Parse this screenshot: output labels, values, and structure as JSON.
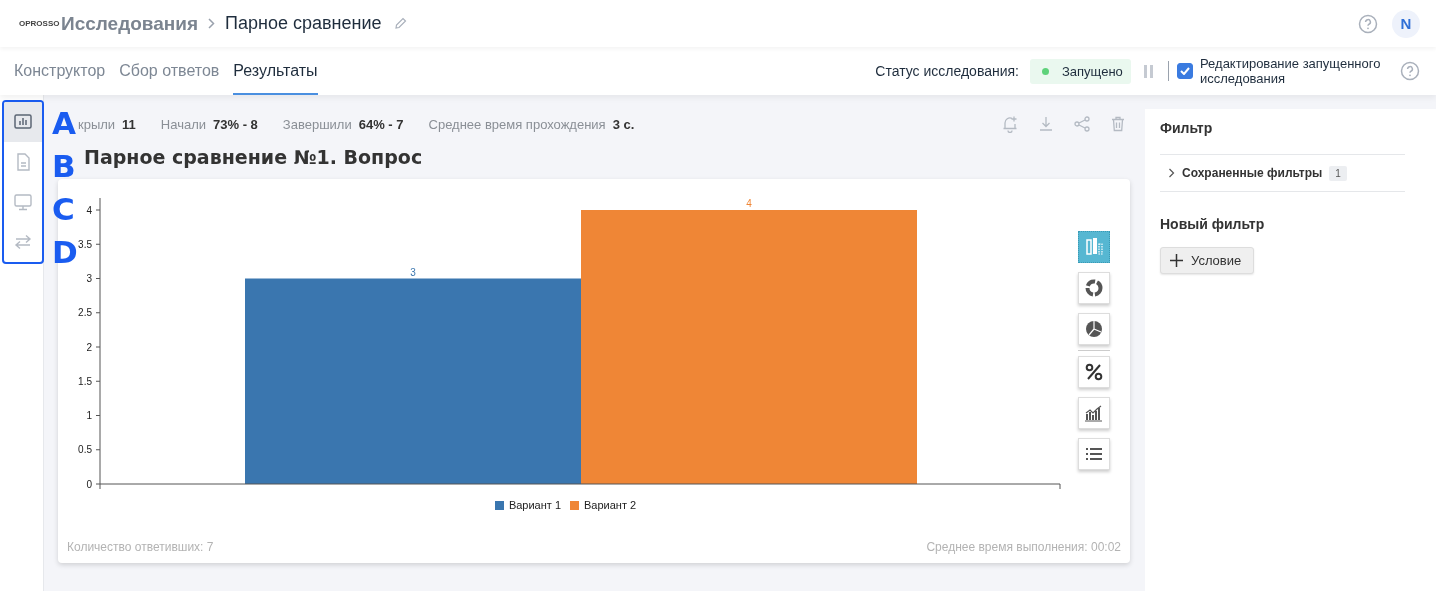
{
  "header": {
    "logo": "OPROSSO",
    "breadcrumb": [
      {
        "label": "Исследования"
      },
      {
        "label": "Парное сравнение"
      }
    ],
    "avatar": "N"
  },
  "tabs": [
    {
      "label": "Конструктор",
      "selected": false
    },
    {
      "label": "Сбор ответов",
      "selected": false
    },
    {
      "label": "Результаты",
      "selected": true
    }
  ],
  "status": {
    "label": "Статус исследования:",
    "value": "Запущено",
    "edit_running": {
      "label": "Редактирование запущенного исследования",
      "checked": true
    }
  },
  "rail": [
    {
      "kind": "chart",
      "selected": true
    },
    {
      "kind": "document",
      "selected": false
    },
    {
      "kind": "monitor",
      "selected": false
    },
    {
      "kind": "swap",
      "selected": false
    }
  ],
  "annotations": [
    {
      "label": "A"
    },
    {
      "label": "B"
    },
    {
      "label": "C"
    },
    {
      "label": "D"
    }
  ],
  "stats": [
    {
      "label": "крыли",
      "value": "11"
    },
    {
      "label": "Начали",
      "value": "73% - 8"
    },
    {
      "label": "Завершили",
      "value": "64% - 7"
    },
    {
      "label": "Среднее время прохождения",
      "value": "3 с."
    }
  ],
  "question_title": "Парное сравнение №1. Вопрос",
  "chart": {
    "chart_data": {
      "type": "bar",
      "ylim": [
        0,
        4
      ],
      "yticks": [
        0,
        0.5,
        1,
        1.5,
        2,
        2.5,
        3,
        3.5,
        4
      ],
      "data_labels": true,
      "series": [
        {
          "name": "Вариант 1",
          "color": "#3a76af",
          "values": [
            3
          ]
        },
        {
          "name": "Вариант 2",
          "color": "#ef8636",
          "values": [
            4
          ]
        }
      ]
    },
    "tools": [
      {
        "kind": "bar",
        "selected": true
      },
      {
        "kind": "donut",
        "selected": false
      },
      {
        "kind": "pie",
        "selected": false
      },
      {
        "kind": "percent",
        "selected": false
      },
      {
        "kind": "trend",
        "selected": false
      },
      {
        "kind": "list",
        "selected": false
      }
    ],
    "respondents": "Количество ответивших: 7",
    "avg_time": "Среднее время выполнения: 00:02"
  },
  "filter": {
    "title": "Фильтр",
    "saved": {
      "label": "Сохраненные фильтры",
      "count": "1",
      "expanded": false
    },
    "new_title": "Новый фильтр",
    "add_button": "Условие"
  }
}
